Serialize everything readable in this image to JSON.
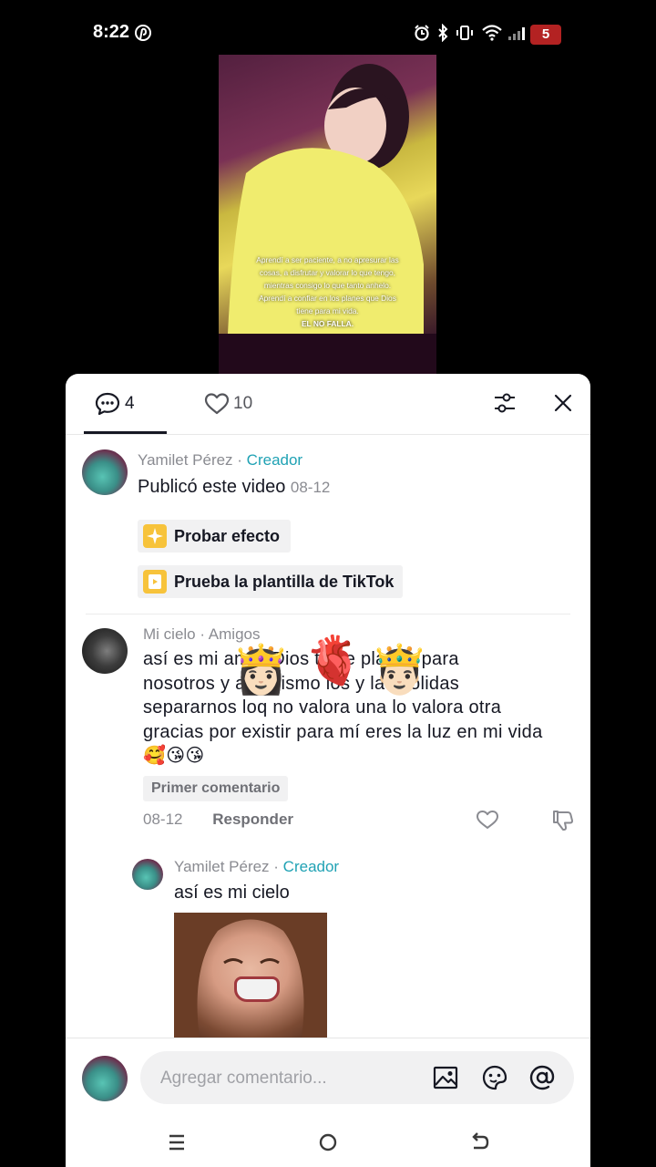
{
  "status_bar": {
    "time": "8:22",
    "battery": "5",
    "icons": [
      "pinterest-icon",
      "alarm-icon",
      "bluetooth-icon",
      "vibrate-icon",
      "wifi-icon",
      "signal-icon",
      "battery-icon"
    ]
  },
  "video": {
    "caption_lines": [
      "Aprendí a ser paciente, a no apresurar las",
      "cosas, a disfrutar y valorar lo que tengo,",
      "mientras consigo lo que tanto anhelo.",
      "Aprendí a confiar en los planes que Dios",
      "tiene para mi vida."
    ],
    "caption_strong": "EL NO FALLA."
  },
  "sheet": {
    "tabs": {
      "comments_count": "4",
      "likes_count": "10"
    },
    "creator_post": {
      "author": "Yamilet Pérez",
      "separator": " · ",
      "role": "Creador",
      "text": "Publicó este video",
      "date": "08-12",
      "chips": [
        "Probar efecto",
        "Prueba la plantilla de TikTok"
      ]
    },
    "comment": {
      "author": "Mi cielo",
      "separator": " · ",
      "relation": "Amigos",
      "lines": [
        "así es mi amor Dios tiene planes para",
        "nosotros y así mismo los y las dolidas",
        "separarnos loq no valora una lo valora otra",
        "gracias por existir para mí eres la luz en mi vida"
      ],
      "emojis": "🥰😘😘",
      "stickers": [
        "👸🏻",
        "🫀",
        "🤴🏻"
      ],
      "badge": "Primer comentario",
      "date": "08-12",
      "reply_label": "Responder"
    },
    "reply": {
      "author": "Yamilet Pérez",
      "separator": " · ",
      "role": "Creador",
      "text": "así es mi cielo"
    },
    "composer": {
      "placeholder": "Agregar comentario...",
      "value": ""
    }
  },
  "colors": {
    "creator_accent": "#20a2b4",
    "text_primary": "#161823",
    "text_secondary": "#8a8b91",
    "chip_bg": "#f1f1f2",
    "battery": "#b32222"
  }
}
